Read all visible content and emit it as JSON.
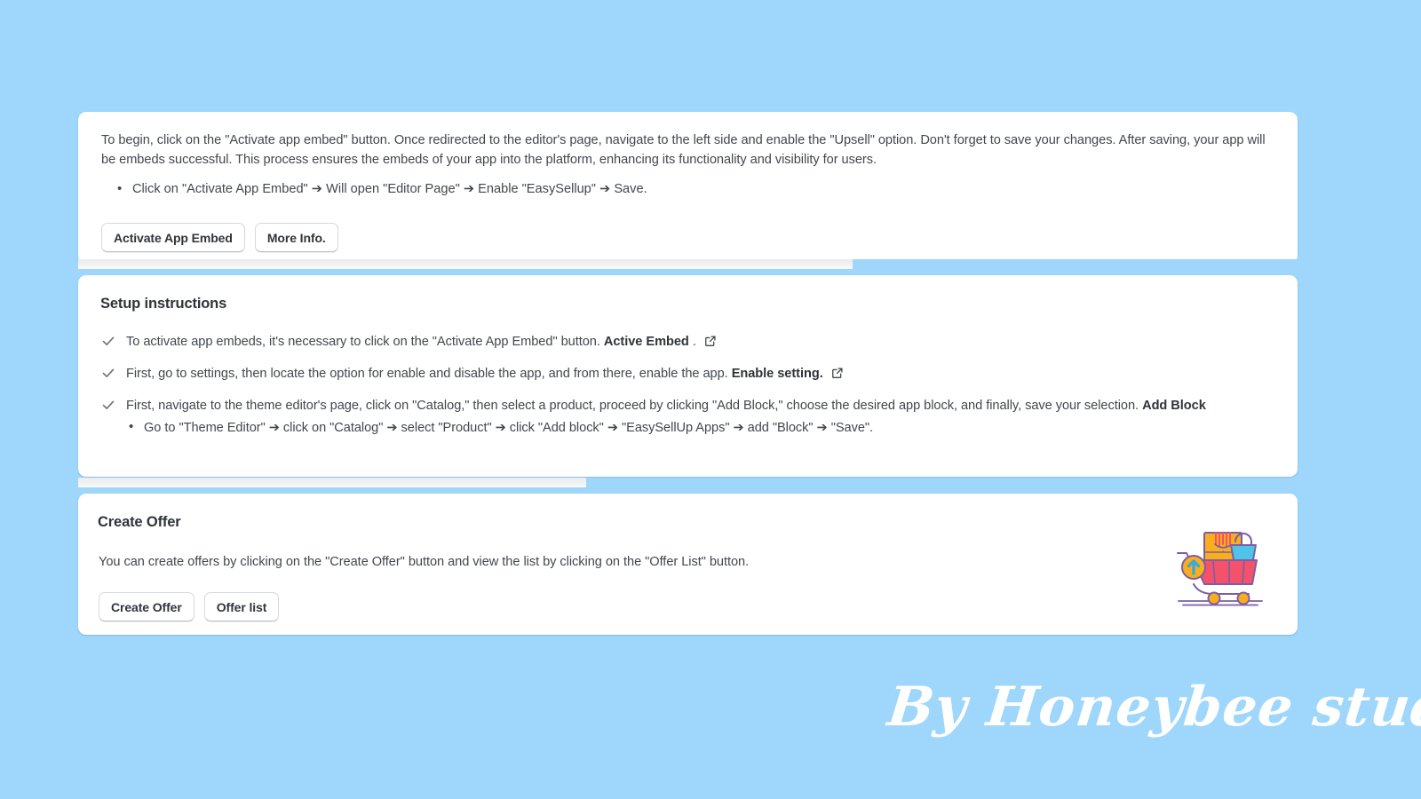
{
  "theme": {
    "background_color": "#9ED7FB",
    "card_color": "#ffffff",
    "text_color": "#42474e",
    "heading_color": "#2f3439"
  },
  "embed_card": {
    "paragraph": "To begin, click on the \"Activate app embed\" button. Once redirected to the editor's page, navigate to the left side and enable the \"Upsell\" option. Don't forget to save your changes. After saving, your app will be embeds successful. This process ensures the embeds of your app into the platform, enhancing its functionality and visibility for users.",
    "bullets": [
      "Click on \"Activate App Embed\" ➔ Will open \"Editor Page\" ➔ Enable \"EasySellup\" ➔ Save."
    ],
    "buttons": {
      "activate_label": "Activate App Embed",
      "more_info_label": "More Info."
    }
  },
  "setup_card": {
    "title": "Setup instructions",
    "items": [
      {
        "text": "To activate app embeds, it's necessary to click on the \"Activate App Embed\" button.",
        "link_label": "Active Embed",
        "trailing": ".",
        "has_external_icon": true,
        "check_icon": "check-icon"
      },
      {
        "text": "First, go to settings, then locate the option for enable and disable the app, and from there, enable the app.",
        "link_label": "Enable setting.",
        "trailing": "",
        "has_external_icon": true,
        "check_icon": "check-icon"
      },
      {
        "text": "First, navigate to the theme editor's page, click on \"Catalog,\" then select a product, proceed by clicking \"Add Block,\" choose the desired app block, and finally, save your selection.",
        "link_label": "Add Block",
        "trailing": "",
        "has_external_icon": false,
        "check_icon": "check-icon",
        "sub_bullets": [
          "Go to \"Theme Editor\" ➔ click on \"Catalog\" ➔ select \"Product\" ➔ click \"Add block\" ➔ \"EasySellUp Apps\" ➔ add \"Block\" ➔ \"Save\"."
        ]
      }
    ]
  },
  "offer_card": {
    "title": "Create Offer",
    "description": "You can create offers by clicking on the \"Create Offer\" button and view the list by clicking on the \"Offer List\" button.",
    "buttons": {
      "create_label": "Create Offer",
      "list_label": "Offer list"
    },
    "illustration": {
      "name": "shopping-cart-illustration",
      "colors": {
        "cart_body": "#F4526B",
        "box": "#FBAE1B",
        "ribbon": "#F4526B",
        "bag": "#4FC3E8",
        "badge": "#FBAE1B",
        "arrow": "#3FA9D6",
        "outline": "#7B5EA7",
        "wheel": "#FBAE1B"
      }
    }
  },
  "signature": {
    "text": "By Honeybee studio"
  }
}
